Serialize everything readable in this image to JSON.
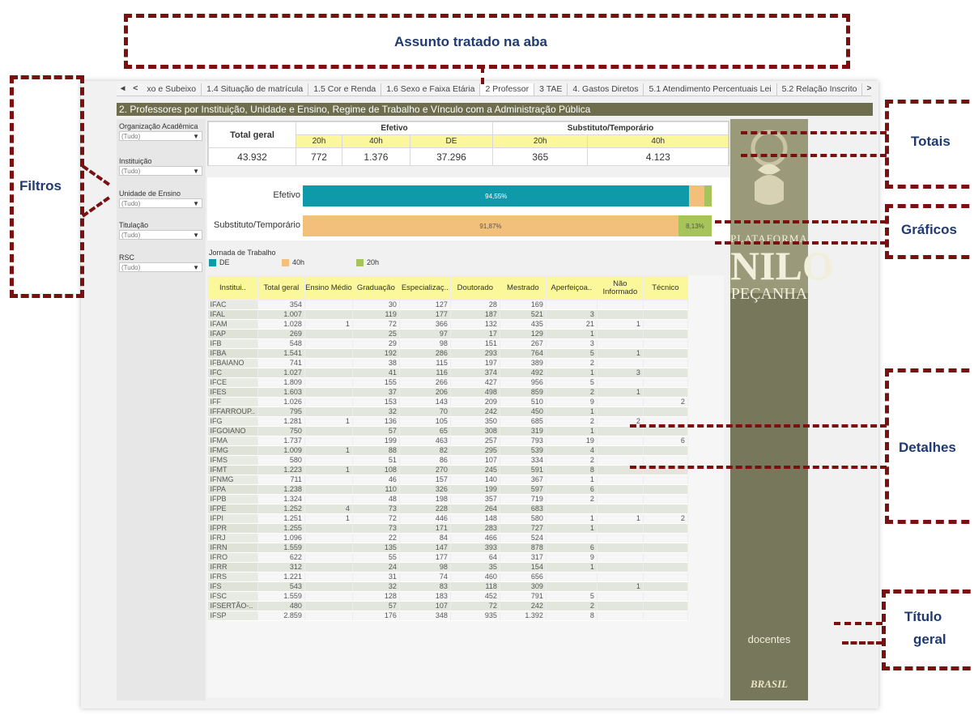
{
  "tabs": [
    "◂",
    "<",
    "xo e Subeixo",
    "1.4 Situação de matrícula",
    "1.5 Cor e Renda",
    "1.6 Sexo e Faixa Etária",
    "2 Professor",
    "3 TAE",
    "4. Gastos Diretos",
    "5.1 Atendimento Percentuais Lei",
    "5.2 Relação Inscrito",
    ">"
  ],
  "active_tab_index": 6,
  "title": "2. Professores por Instituição, Unidade e Ensino, Regime de Trabalho e Vínculo com a Administração Pública",
  "filters": [
    {
      "label": "Organização Acadêmica",
      "value": "(Tudo)"
    },
    {
      "label": "Instituição",
      "value": "(Tudo)"
    },
    {
      "label": "Unidade de Ensino",
      "value": "(Tudo)"
    },
    {
      "label": "Titulação",
      "value": "(Tudo)"
    },
    {
      "label": "RSC",
      "value": "(Tudo)"
    }
  ],
  "totals": {
    "total_label": "Total geral",
    "efetivo_label": "Efetivo",
    "substituto_label": "Substituto/Temporário",
    "sub_headers": [
      "20h",
      "40h",
      "DE",
      "20h",
      "40h"
    ],
    "values": [
      "43.932",
      "772",
      "1.376",
      "37.296",
      "365",
      "4.123"
    ]
  },
  "bars": {
    "rows": [
      {
        "label": "Efetivo",
        "segments": [
          {
            "key": "DE",
            "pct": 94.55,
            "text": "94,55%"
          },
          {
            "key": "40h",
            "pct": 3.58,
            "text": ""
          },
          {
            "key": "20h",
            "pct": 1.87,
            "text": ""
          }
        ]
      },
      {
        "label": "Substituto/Temporário",
        "segments": [
          {
            "key": "40h",
            "pct": 91.87,
            "text": "91,87%"
          },
          {
            "key": "20h",
            "pct": 8.13,
            "text": "8,13%"
          }
        ]
      }
    ],
    "colors": {
      "DE": "#0f9aaa",
      "40h": "#f3c07c",
      "20h": "#a6c45a"
    }
  },
  "legend": {
    "title": "Jornada de Trabalho",
    "items": [
      {
        "key": "DE",
        "label": "DE"
      },
      {
        "key": "40h",
        "label": "40h"
      },
      {
        "key": "20h",
        "label": "20h"
      }
    ]
  },
  "detail": {
    "columns": [
      "Institui..",
      "Total geral",
      "Ensino Médio",
      "Graduação",
      "Especializaç..",
      "Doutorado",
      "Mestrado",
      "Aperfeiçoa..",
      "Não Informado",
      "Técnico"
    ],
    "rows": [
      [
        "IFAC",
        "354",
        "",
        "30",
        "127",
        "28",
        "169",
        "",
        "",
        ""
      ],
      [
        "IFAL",
        "1.007",
        "",
        "119",
        "177",
        "187",
        "521",
        "3",
        "",
        ""
      ],
      [
        "IFAM",
        "1.028",
        "1",
        "72",
        "366",
        "132",
        "435",
        "21",
        "1",
        ""
      ],
      [
        "IFAP",
        "269",
        "",
        "25",
        "97",
        "17",
        "129",
        "1",
        "",
        ""
      ],
      [
        "IFB",
        "548",
        "",
        "29",
        "98",
        "151",
        "267",
        "3",
        "",
        ""
      ],
      [
        "IFBA",
        "1.541",
        "",
        "192",
        "286",
        "293",
        "764",
        "5",
        "1",
        ""
      ],
      [
        "IFBAIANO",
        "741",
        "",
        "38",
        "115",
        "197",
        "389",
        "2",
        "",
        ""
      ],
      [
        "IFC",
        "1.027",
        "",
        "41",
        "116",
        "374",
        "492",
        "1",
        "3",
        ""
      ],
      [
        "IFCE",
        "1.809",
        "",
        "155",
        "266",
        "427",
        "956",
        "5",
        "",
        ""
      ],
      [
        "IFES",
        "1.603",
        "",
        "37",
        "206",
        "498",
        "859",
        "2",
        "1",
        ""
      ],
      [
        "IFF",
        "1.026",
        "",
        "153",
        "143",
        "209",
        "510",
        "9",
        "",
        "2"
      ],
      [
        "IFFARROUP..",
        "795",
        "",
        "32",
        "70",
        "242",
        "450",
        "1",
        "",
        ""
      ],
      [
        "IFG",
        "1.281",
        "1",
        "136",
        "105",
        "350",
        "685",
        "2",
        "2",
        ""
      ],
      [
        "IFGOIANO",
        "750",
        "",
        "57",
        "65",
        "308",
        "319",
        "1",
        "",
        ""
      ],
      [
        "IFMA",
        "1.737",
        "",
        "199",
        "463",
        "257",
        "793",
        "19",
        "",
        "6"
      ],
      [
        "IFMG",
        "1.009",
        "1",
        "88",
        "82",
        "295",
        "539",
        "4",
        "",
        ""
      ],
      [
        "IFMS",
        "580",
        "",
        "51",
        "86",
        "107",
        "334",
        "2",
        "",
        ""
      ],
      [
        "IFMT",
        "1.223",
        "1",
        "108",
        "270",
        "245",
        "591",
        "8",
        "",
        ""
      ],
      [
        "IFNMG",
        "711",
        "",
        "46",
        "157",
        "140",
        "367",
        "1",
        "",
        ""
      ],
      [
        "IFPA",
        "1.238",
        "",
        "110",
        "326",
        "199",
        "597",
        "6",
        "",
        ""
      ],
      [
        "IFPB",
        "1.324",
        "",
        "48",
        "198",
        "357",
        "719",
        "2",
        "",
        ""
      ],
      [
        "IFPE",
        "1.252",
        "4",
        "73",
        "228",
        "264",
        "683",
        "",
        "",
        ""
      ],
      [
        "IFPI",
        "1.251",
        "1",
        "72",
        "446",
        "148",
        "580",
        "1",
        "1",
        "2"
      ],
      [
        "IFPR",
        "1.255",
        "",
        "73",
        "171",
        "283",
        "727",
        "1",
        "",
        ""
      ],
      [
        "IFRJ",
        "1.096",
        "",
        "22",
        "84",
        "466",
        "524",
        "",
        "",
        ""
      ],
      [
        "IFRN",
        "1.559",
        "",
        "135",
        "147",
        "393",
        "878",
        "6",
        "",
        ""
      ],
      [
        "IFRO",
        "622",
        "",
        "55",
        "177",
        "64",
        "317",
        "9",
        "",
        ""
      ],
      [
        "IFRR",
        "312",
        "",
        "24",
        "98",
        "35",
        "154",
        "1",
        "",
        ""
      ],
      [
        "IFRS",
        "1.221",
        "",
        "31",
        "74",
        "460",
        "656",
        "",
        "",
        ""
      ],
      [
        "IFS",
        "543",
        "",
        "32",
        "83",
        "118",
        "309",
        "",
        "1",
        ""
      ],
      [
        "IFSC",
        "1.559",
        "",
        "128",
        "183",
        "452",
        "791",
        "5",
        "",
        ""
      ],
      [
        "IFSERTÃO-..",
        "480",
        "",
        "57",
        "107",
        "72",
        "242",
        "2",
        "",
        ""
      ],
      [
        "IFSP",
        "2.859",
        "",
        "176",
        "348",
        "935",
        "1.392",
        "8",
        "",
        ""
      ]
    ]
  },
  "brand": {
    "line1": "PLATAFORMA",
    "line2": "NILO",
    "line3": "PEÇANHA",
    "subtitle": "docentes",
    "footer": "BRASIL"
  },
  "annotations": {
    "assunto": "Assunto tratado na aba",
    "filtros": "Filtros",
    "totais": "Totais",
    "graficos": "Gráficos",
    "detalhes": "Detalhes",
    "titulo1": "Título",
    "titulo2": "geral"
  }
}
